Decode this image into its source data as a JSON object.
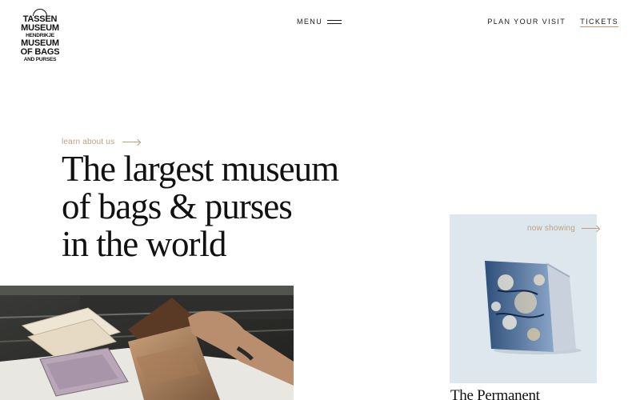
{
  "logo": {
    "lines_big": [
      "TASSEN",
      "MUSEUM"
    ],
    "line_mid": "HENDRIKJE",
    "lines_big2": [
      "MUSEUM",
      "OF BAGS"
    ],
    "line_small": "AND PURSES"
  },
  "header": {
    "menu_label": "MENU",
    "plan_visit": "PLAN YOUR VISIT",
    "tickets": "TICKETS"
  },
  "hero": {
    "learn_link": "learn about us",
    "headline": [
      "The largest museum",
      "of bags & purses",
      "in the world"
    ]
  },
  "exhibit": {
    "label": "now showing",
    "title": "The Permanent"
  },
  "colors": {
    "accent": "#b9a27e",
    "tickets_underline": "#c8916e",
    "card_bg": "#dfe7ee"
  },
  "icons": [
    "menu-icon",
    "arrow-right-icon"
  ]
}
